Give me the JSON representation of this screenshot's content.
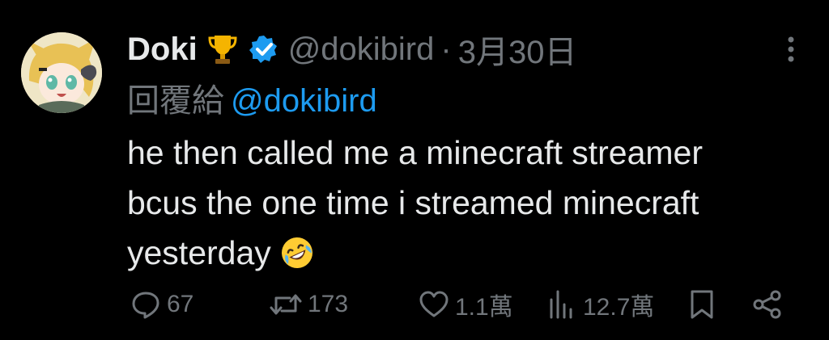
{
  "tweet": {
    "author": {
      "display_name": "Doki",
      "handle": "@dokibird",
      "badge_icon": "trophy-icon",
      "verified_icon": "verified-badge-icon"
    },
    "separator": "·",
    "date": "3月30日",
    "reply": {
      "prefix": "回覆給",
      "mention": "@dokibird"
    },
    "text_lines": [
      "he then called me a minecraft streamer",
      "bcus the one time i streamed minecraft",
      "yesterday"
    ],
    "emoji": "rolling-on-floor-laughing-emoji",
    "actions": {
      "replies": "67",
      "retweets": "173",
      "likes": "1.1萬",
      "views": "12.7萬"
    }
  },
  "colors": {
    "background": "#000000",
    "text_primary": "#e7e9ea",
    "text_secondary": "#71767b",
    "accent": "#1d9bf0",
    "trophy_gold": "#f5b400"
  }
}
